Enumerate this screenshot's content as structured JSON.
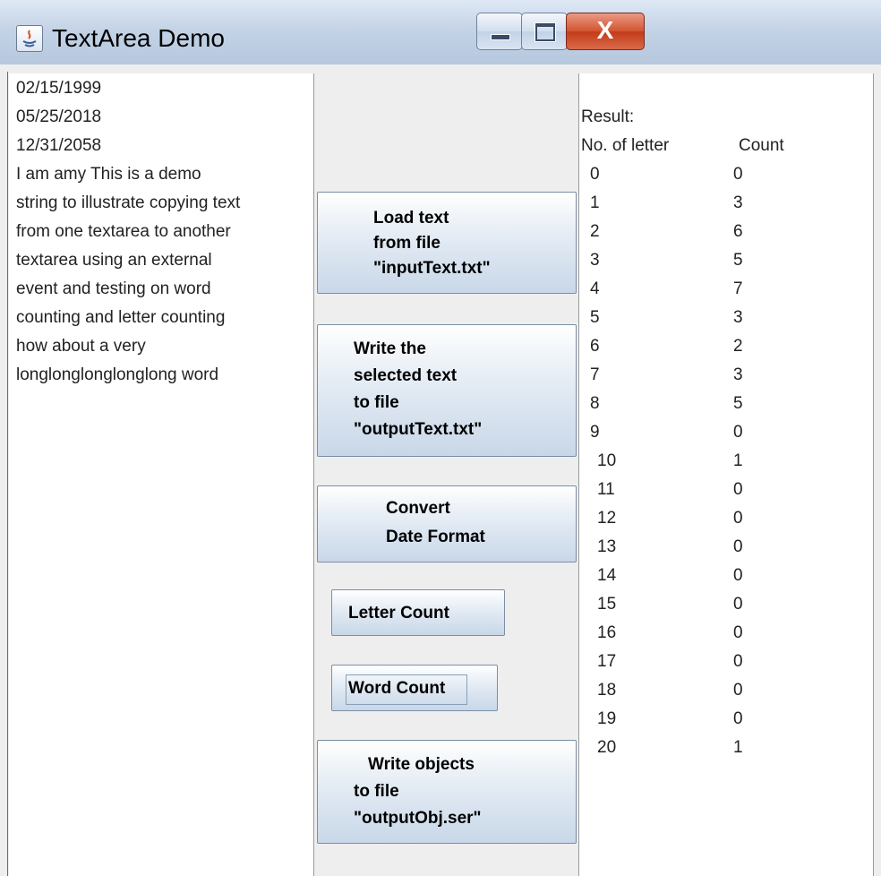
{
  "window": {
    "title": "TextArea Demo",
    "close_glyph": "X"
  },
  "left_text": {
    "lines": [
      "02/15/1999",
      "05/25/2018",
      "12/31/2058",
      "I am amy This is a demo",
      "string to illustrate copying text",
      "from one textarea to another",
      "textarea using an external",
      "event and testing on word",
      "counting and letter counting",
      "how about a very",
      "longlonglonglonglong word"
    ]
  },
  "buttons": {
    "load": [
      "Load text",
      "from file",
      "\"inputText.txt\""
    ],
    "write_selected": [
      "Write the",
      "selected text",
      "to file",
      "\"outputText.txt\""
    ],
    "convert_date": [
      "Convert",
      "Date Format"
    ],
    "letter_count": "Letter Count",
    "word_count": "Word Count",
    "write_objects": [
      "Write objects",
      "to file",
      "\"outputObj.ser\""
    ]
  },
  "result": {
    "title": "Result:",
    "col_letters": "No. of letter",
    "col_count": "Count",
    "rows": [
      [
        "0",
        "0"
      ],
      [
        "1",
        "3"
      ],
      [
        "2",
        "6"
      ],
      [
        "3",
        "5"
      ],
      [
        "4",
        "7"
      ],
      [
        "5",
        "3"
      ],
      [
        "6",
        "2"
      ],
      [
        "7",
        "3"
      ],
      [
        "8",
        "5"
      ],
      [
        "9",
        "0"
      ],
      [
        "10",
        "1"
      ],
      [
        "11",
        "0"
      ],
      [
        "12",
        "0"
      ],
      [
        "13",
        "0"
      ],
      [
        "14",
        "0"
      ],
      [
        "15",
        "0"
      ],
      [
        "16",
        "0"
      ],
      [
        "17",
        "0"
      ],
      [
        "18",
        "0"
      ],
      [
        "19",
        "0"
      ],
      [
        "20",
        "1"
      ]
    ]
  }
}
